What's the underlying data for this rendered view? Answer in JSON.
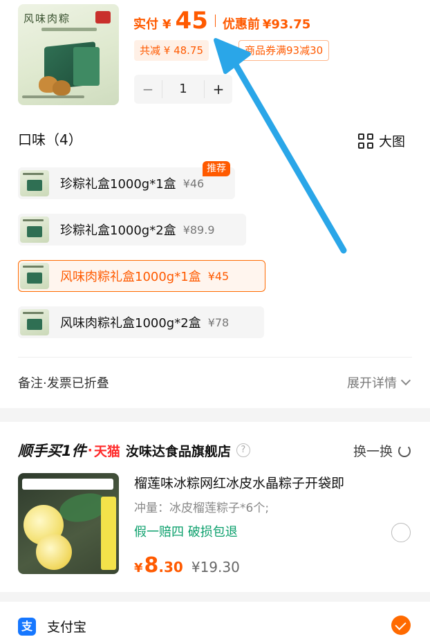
{
  "product": {
    "image_title": "风味肉粽",
    "paid_label": "实付",
    "currency": "¥",
    "paid_value": "45",
    "before_label": "优惠前",
    "before_value": "¥93.75",
    "total_discount": "共减 ¥ 48.75",
    "coupon": "商品券满93减30",
    "stepper": {
      "minus": "−",
      "qty": "1",
      "plus": "+"
    }
  },
  "flavor": {
    "title": "口味（4）",
    "big_view": "大图",
    "recommend_tag": "推荐",
    "options": [
      {
        "name": "珍粽礼盒1000g*1盒",
        "price": "¥46"
      },
      {
        "name": "珍粽礼盒1000g*2盒",
        "price": "¥89.9"
      },
      {
        "name": "风味肉粽礼盒1000g*1盒",
        "price": "¥45"
      },
      {
        "name": "风味肉粽礼盒1000g*2盒",
        "price": "¥78"
      }
    ],
    "selected_index": 2
  },
  "notes": {
    "label": "备注·发票已折叠",
    "expand": "展开详情"
  },
  "addon": {
    "brand": "顺手买1件",
    "dot": "·",
    "platform": "天猫",
    "shop": "汝味达食品旗舰店",
    "help_icon": "?",
    "swap": "换一换",
    "title": "榴莲味冰粽网红冰皮水晶粽子开袋即",
    "spec": "冲量：冰皮榴莲粽子*6个;",
    "tags": "假一赔四  破损包退",
    "currency": "¥",
    "price_int": "8",
    "price_dec": ".30",
    "orig_price": "¥19.30"
  },
  "payment": {
    "icon_text": "支",
    "label": "支付宝"
  },
  "colors": {
    "accent": "#ff5a00",
    "arrow": "#2aa6e8",
    "green": "#0a9f6b",
    "alipay": "#1677ff"
  }
}
